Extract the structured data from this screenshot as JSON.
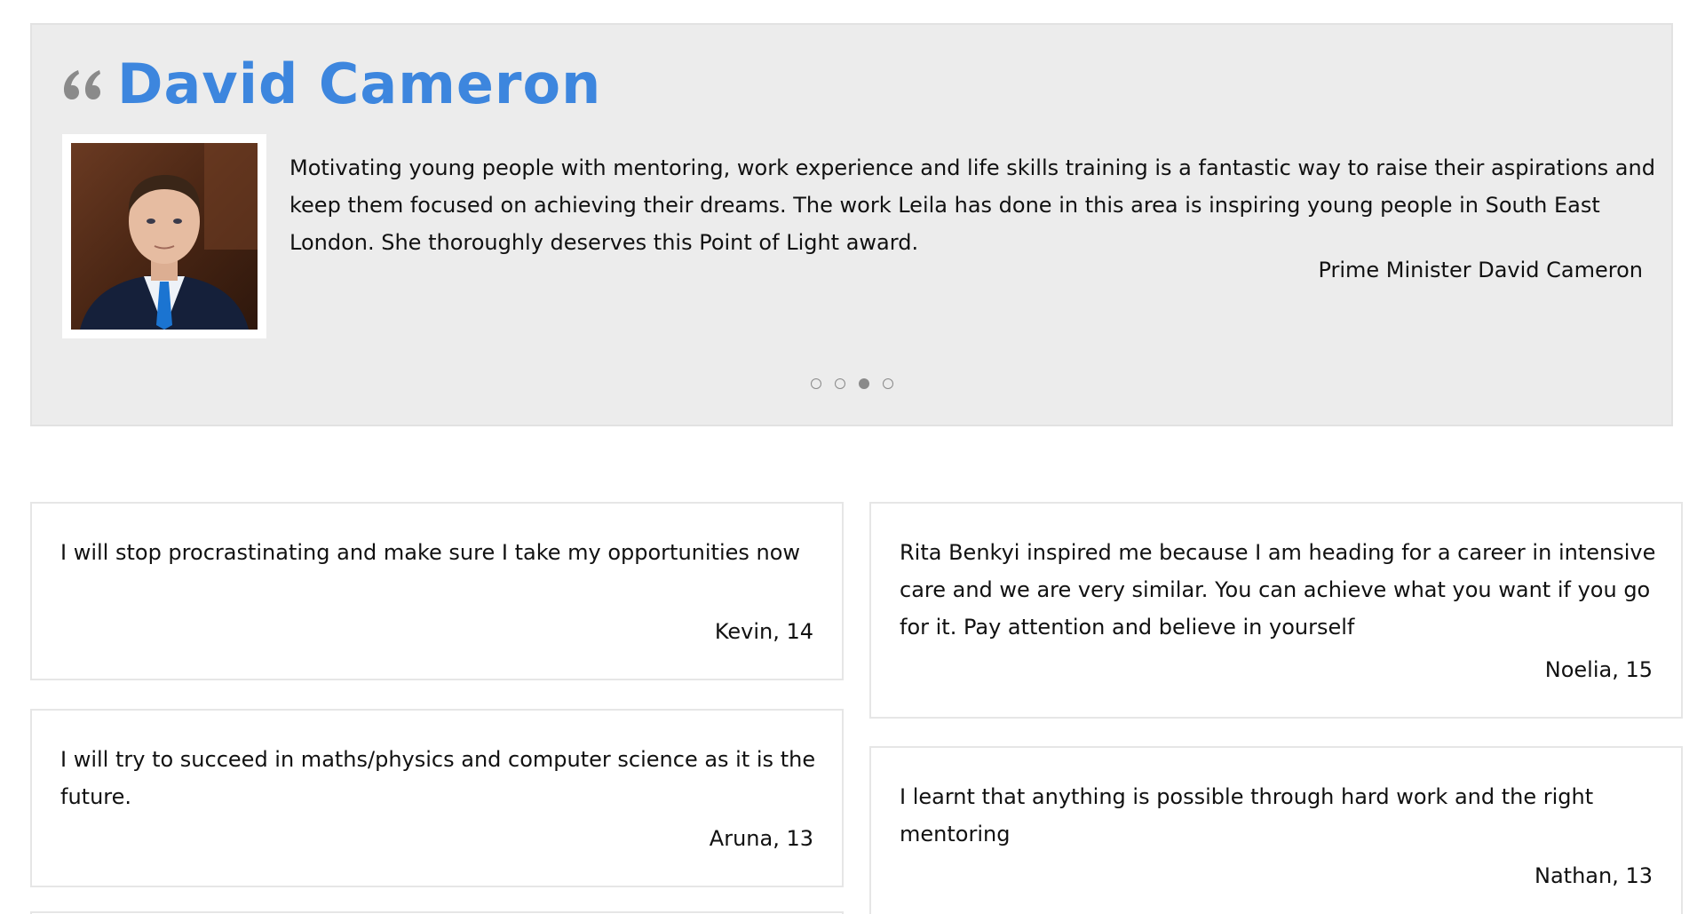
{
  "feature": {
    "name": "David Cameron",
    "quote": "Motivating young people with mentoring, work experience and life skills training is a fantastic way to raise their aspirations and keep them focused on achieving their dreams. The work Leila has done in this area is inspiring young people in South East London. She thoroughly deserves this Point of Light award.",
    "author": "Prime Minister David Cameron",
    "accent_color": "#3d86de",
    "icon": "quote-icon",
    "slides": 4,
    "active_slide": 3
  },
  "testimonials": [
    {
      "text": "I will stop procrastinating and make sure I take my opportunities now",
      "author": "Kevin, 14"
    },
    {
      "text": "Rita Benkyi inspired me because I am heading for a career in intensive care and we are very similar. You can achieve what you want if you go for it. Pay attention and believe in yourself",
      "author": "Noelia, 15"
    },
    {
      "text": "I will try to succeed in maths/physics and computer science as it is the future.",
      "author": "Aruna, 13"
    },
    {
      "text": "I learnt that anything is possible through hard work and the right mentoring",
      "author": "Nathan, 13"
    }
  ]
}
